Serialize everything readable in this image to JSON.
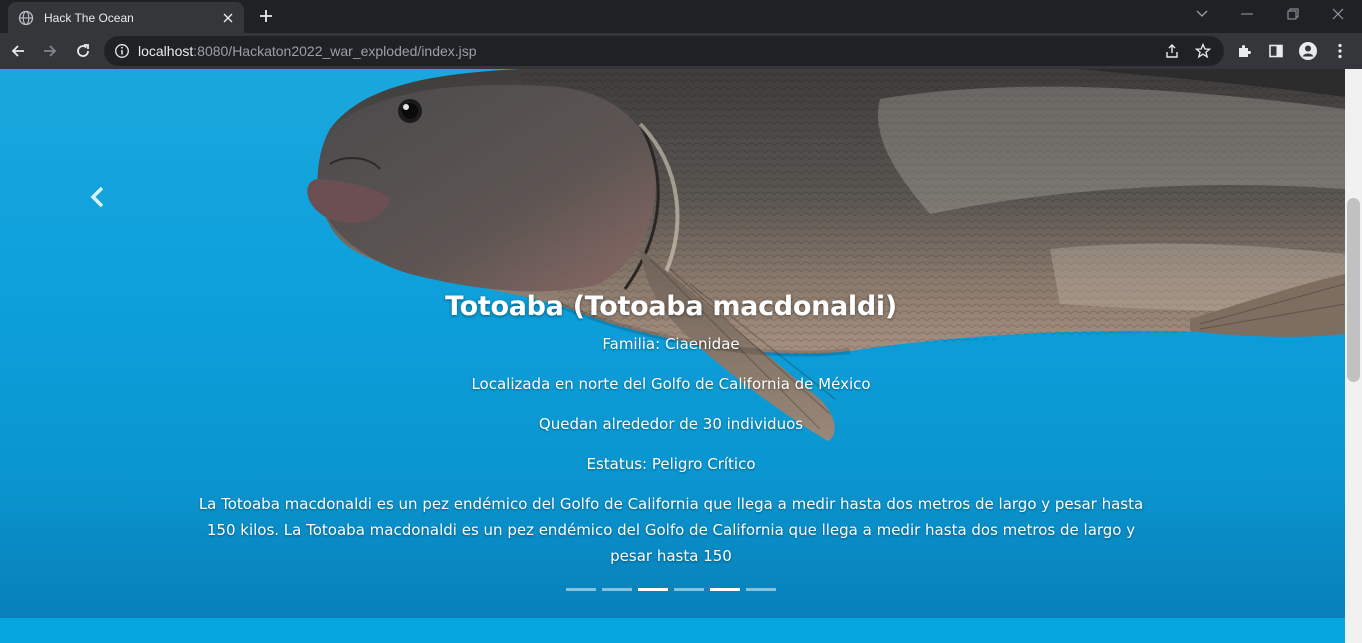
{
  "browser": {
    "tab_title": "Hack The Ocean",
    "url_host": "localhost",
    "url_rest": ":8080/Hackaton2022_war_exploded/index.jsp"
  },
  "slide": {
    "title": "Totoaba (Totoaba macdonaldi)",
    "family": "Familia: Ciaenidae",
    "location": "Localizada en norte del Golfo de California de México",
    "population": "Quedan alrededor de 30 individuos",
    "status": "Estatus: Peligro Crítico",
    "description": "La Totoaba macdonaldi es un pez endémico del Golfo de California que llega a medir hasta dos metros de largo y pesar hasta 150 kilos. La Totoaba macdonaldi es un pez endémico del Golfo de California que llega a medir hasta dos metros de largo y pesar hasta 150"
  },
  "carousel": {
    "indicator_count": 6,
    "active_indicators": [
      2,
      4
    ]
  },
  "colors": {
    "water": "#0da0db",
    "chrome_dark": "#202124",
    "chrome_toolbar": "#35363a"
  }
}
